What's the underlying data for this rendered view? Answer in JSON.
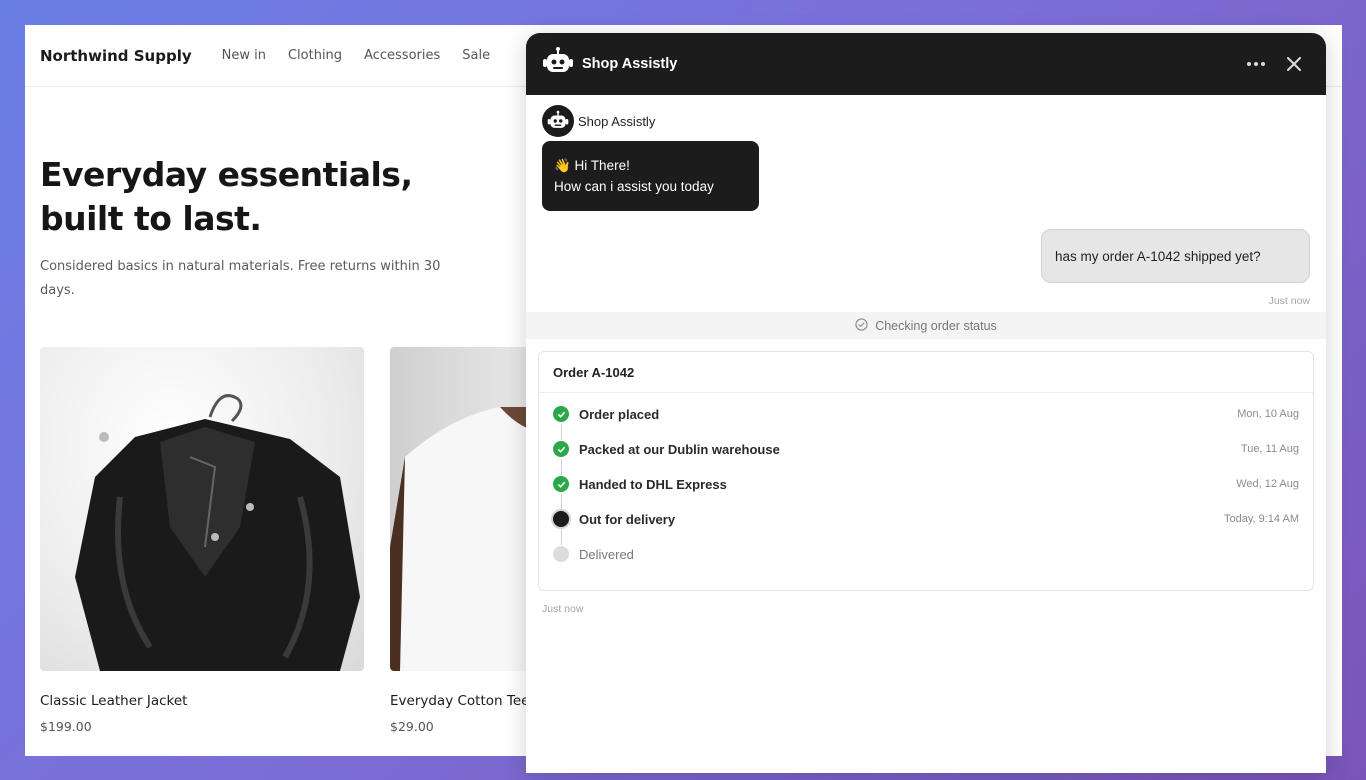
{
  "site": {
    "brand": "Northwind Supply",
    "nav": [
      "New in",
      "Clothing",
      "Accessories",
      "Sale"
    ]
  },
  "hero": {
    "title_line1": "Everyday essentials,",
    "title_line2": "built to last.",
    "subtitle": "Considered basics in natural materials. Free returns within 30 days."
  },
  "products": [
    {
      "name": "Classic Leather Jacket",
      "price": "$199.00"
    },
    {
      "name": "Everyday Cotton Tee",
      "price": "$29.00"
    }
  ],
  "chat": {
    "title": "Shop Assistly",
    "bot_name": "Shop Assistly",
    "greeting_line1": "👋 Hi There!",
    "greeting_line2": "How can i assist you today",
    "user_message": "has my order A-1042 shipped yet?",
    "user_timestamp": "Just now",
    "status_text": "Checking order status",
    "bot_timestamp": "Just now",
    "order": {
      "title": "Order A-1042",
      "steps": [
        {
          "label": "Order placed",
          "date": "Mon, 10 Aug",
          "state": "done"
        },
        {
          "label": "Packed at our Dublin warehouse",
          "date": "Tue, 11 Aug",
          "state": "done"
        },
        {
          "label": "Handed to DHL Express",
          "date": "Wed, 12 Aug",
          "state": "done"
        },
        {
          "label": "Out for delivery",
          "date": "Today, 9:14 AM",
          "state": "current"
        },
        {
          "label": "Delivered",
          "date": "",
          "state": "pending"
        }
      ]
    }
  },
  "colors": {
    "header_bg": "#1c1c1c",
    "done_green": "#2aa84a",
    "bg_gradient_start": "#6a7fe6",
    "bg_gradient_end": "#7a55b8"
  }
}
